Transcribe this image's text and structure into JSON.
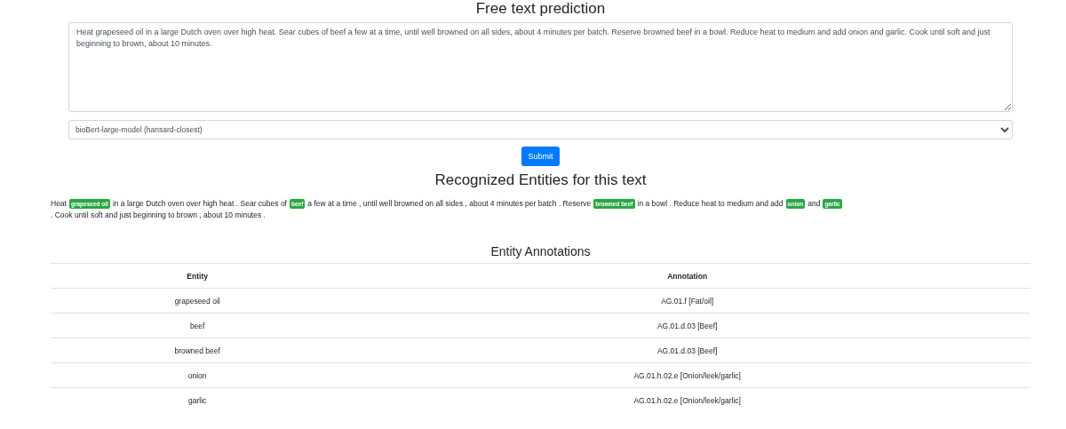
{
  "form": {
    "title": "Free text prediction",
    "text": "Heat grapeseed oil in a large Dutch oven over high heat. Sear cubes of beef a few at a time, until well browned on all sides, about 4 minutes per batch. Reserve browned beef in a bowl. Reduce heat to medium and add onion and garlic. Cook until soft and just beginning to brown, about 10 minutes.",
    "model": "bioBert-large-model (hansard-closest)",
    "submit": "Submit"
  },
  "entities": {
    "title": "Recognized Entities for this text",
    "segments": [
      {
        "kind": "text",
        "text": "Heat"
      },
      {
        "kind": "entity",
        "text": "grapeseed oil"
      },
      {
        "kind": "text",
        "text": "in a large Dutch oven over high heat . Sear cubes of"
      },
      {
        "kind": "entity",
        "text": "beef"
      },
      {
        "kind": "text",
        "text": "a few at a time , until well browned on all sides , about 4 minutes per batch . Reserve"
      },
      {
        "kind": "entity",
        "text": "browned beef"
      },
      {
        "kind": "text",
        "text": "in a bowl . Reduce heat to medium and add"
      },
      {
        "kind": "entity",
        "text": "onion"
      },
      {
        "kind": "text",
        "text": "and"
      },
      {
        "kind": "entity",
        "text": "garlic"
      },
      {
        "kind": "text",
        "text": ". Cook until soft and just beginning to brown , about 10 minutes ."
      }
    ]
  },
  "annotations": {
    "title": "Entity Annotations",
    "columns": [
      "Entity",
      "Annotation"
    ],
    "rows": [
      [
        "grapeseed oil",
        "AG.01.f [Fat/oil]"
      ],
      [
        "beef",
        "AG.01.d.03 [Beef]"
      ],
      [
        "browned beef",
        "AG.01.d.03 [Beef]"
      ],
      [
        "onion",
        "AG.01.h.02.e [Onion/leek/garlic]"
      ],
      [
        "garlic",
        "AG.01.h.02.e [Onion/leek/garlic]"
      ]
    ]
  }
}
